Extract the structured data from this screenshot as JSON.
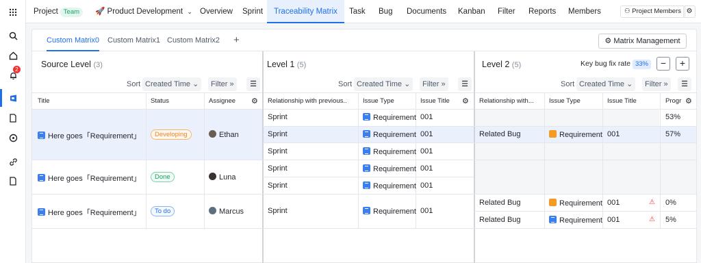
{
  "nav": {
    "project_label": "Project",
    "team_tag": "Team",
    "project_name": "Product Development",
    "items": [
      "Overview",
      "Sprint",
      "Traceability Matrix",
      "Task",
      "Bug",
      "Documents",
      "Kanban",
      "Filter",
      "Reports",
      "Members"
    ],
    "active": "Traceability Matrix",
    "project_members_label": "Project Members",
    "notification_count": "2"
  },
  "tabs": [
    "Custom Matrix0",
    "Custom Matrix1",
    "Custom Matrix2"
  ],
  "matrix_management_label": "Matrix Management",
  "source": {
    "title": "Source Level",
    "count": "(3)",
    "sort_label": "Sort",
    "sort_value": "Created Time",
    "filter_label": "Filter",
    "headers": [
      "Title",
      "Status",
      "Assignee"
    ],
    "rows": [
      {
        "title": "Here goes「Requirement」",
        "status": "Developing",
        "assignee": "Ethan"
      },
      {
        "title": "Here goes「Requirement」",
        "status": "Done",
        "assignee": "Luna"
      },
      {
        "title": "Here goes「Requirement」",
        "status": "To do",
        "assignee": "Marcus"
      }
    ]
  },
  "level1": {
    "title": "Level 1",
    "count": "(5)",
    "sort_label": "Sort",
    "sort_value": "Created Time",
    "filter_label": "Filter",
    "headers": [
      "Relationship with previous...",
      "Issue Type",
      "Issue Title"
    ],
    "rows": [
      {
        "rel": "Sprint",
        "type": "Requirement",
        "title": "001"
      },
      {
        "rel": "Sprint",
        "type": "Requirement",
        "title": "001"
      },
      {
        "rel": "Sprint",
        "type": "Requirement",
        "title": "001"
      },
      {
        "rel": "Sprint",
        "type": "Requirement",
        "title": "001"
      },
      {
        "rel": "Sprint",
        "type": "Requirement",
        "title": "001"
      },
      {
        "rel": "Sprint",
        "type": "Requirement",
        "title": "001"
      }
    ]
  },
  "level2": {
    "title": "Level 2",
    "count": "(5)",
    "key_bug_label": "Key bug fix rate",
    "key_bug_value": "33%",
    "sort_label": "Sort",
    "sort_value": "Created Time",
    "filter_label": "Filter",
    "headers": [
      "Relationship with...",
      "Issue Type",
      "Issue Title",
      "Progr"
    ],
    "progress_rows": [
      "53%",
      "57%"
    ],
    "row_a": {
      "rel": "Related Bug",
      "type": "Requirement",
      "title": "001"
    },
    "row_b": {
      "rel": "Related Bug",
      "type": "Requirement",
      "title": "001",
      "progress": "0%"
    },
    "row_c": {
      "rel": "Related Bug",
      "type": "Requirement",
      "title": "001",
      "progress": "5%"
    }
  }
}
